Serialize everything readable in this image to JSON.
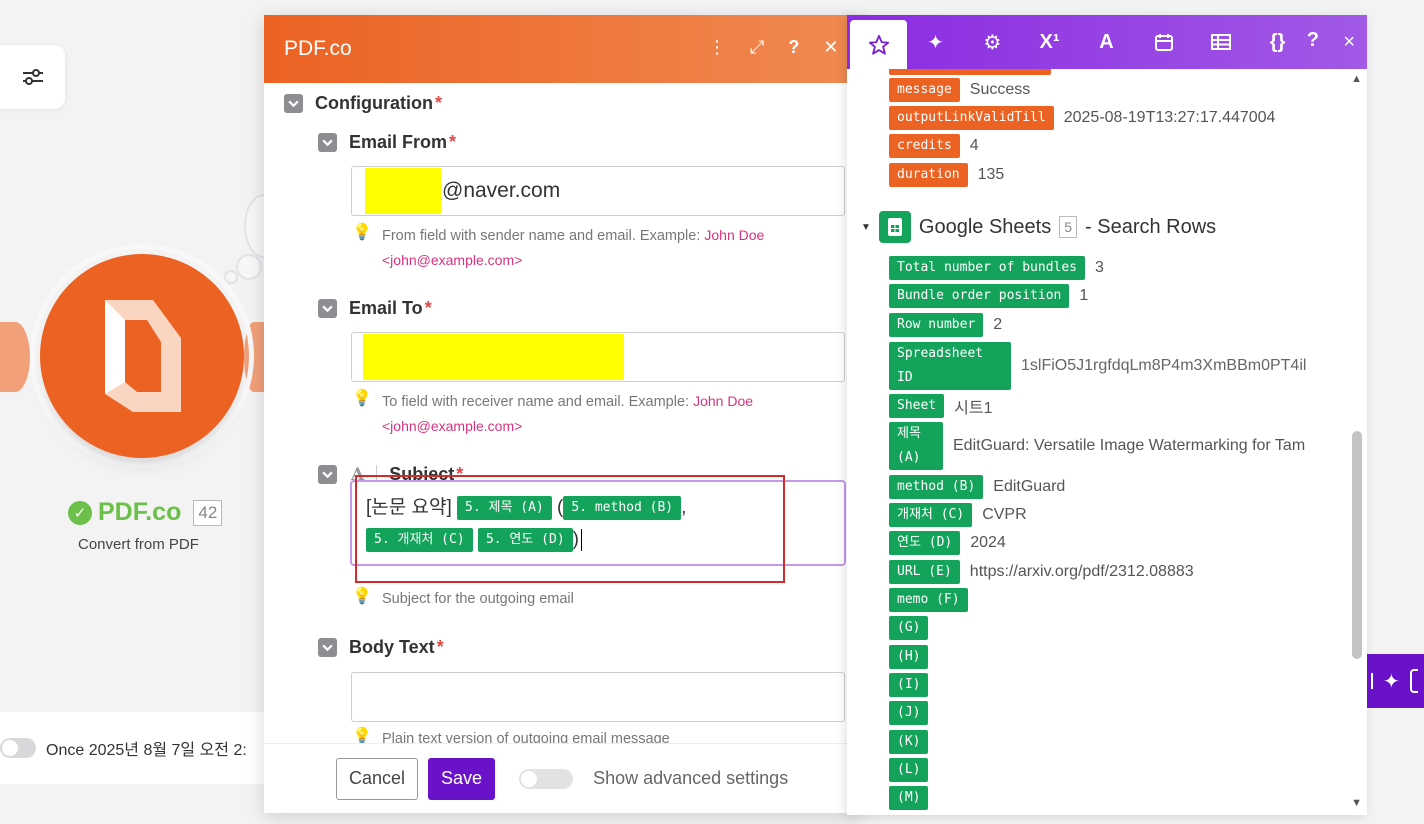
{
  "canvas": {
    "node": {
      "name": "PDF.co",
      "badge": "42",
      "subtitle": "Convert from PDF"
    },
    "schedule": {
      "text": "Once 2025년 8월 7일 오전 2:"
    }
  },
  "modal": {
    "title": "PDF.co",
    "section": {
      "label": "Configuration",
      "required": "*"
    },
    "email_from": {
      "label": "Email From",
      "required": "*",
      "value": "@naver.com",
      "hint": "From field with sender name and email. Example:",
      "example": "John Doe <john@example.com>"
    },
    "email_to": {
      "label": "Email To",
      "required": "*",
      "hint": "To field with receiver name and email. Example:",
      "example": "John Doe <john@example.com>"
    },
    "subject": {
      "label": "Subject",
      "required": "*",
      "prefix": "[논문 요약]",
      "pill1": "5. 제목 (A)",
      "open": "(",
      "pill2": "5. method (B)",
      "comma": ",",
      "pill3": "5. 개재처 (C)",
      "pill4": "5. 연도 (D)",
      "close": ")",
      "hint": "Subject for the outgoing email"
    },
    "body_text": {
      "label": "Body Text",
      "required": "*",
      "hint": "Plain text version of outgoing email message"
    },
    "footer": {
      "cancel": "Cancel",
      "save": "Save",
      "advanced": "Show advanced settings"
    }
  },
  "panel": {
    "tabs": [
      "star",
      "sparkle",
      "settings",
      "x1",
      "A",
      "calendar",
      "table",
      "braces"
    ],
    "help": "?",
    "close": "×",
    "pdfco_items": [
      {
        "key": "message",
        "value": "Success"
      },
      {
        "key": "outputLinkValidTill",
        "value": "2025-08-19T13:27:17.447004"
      },
      {
        "key": "credits",
        "value": "4"
      },
      {
        "key": "duration",
        "value": "135"
      }
    ],
    "module": {
      "name": "Google Sheets",
      "badge": "5",
      "action": "- Search Rows"
    },
    "sheet_items": [
      {
        "key": "Total number of bundles",
        "value": "3"
      },
      {
        "key": "Bundle order position",
        "value": "1"
      },
      {
        "key": "Row number",
        "value": "2"
      },
      {
        "key": "Spreadsheet ID",
        "value": "1slFiO5J1rgfdqLm8P4m3XmBBm0PT4il"
      },
      {
        "key": "Sheet",
        "value": "시트1"
      },
      {
        "key": "제목 (A)",
        "value": "EditGuard: Versatile Image Watermarking for Tam"
      },
      {
        "key": "method (B)",
        "value": "EditGuard"
      },
      {
        "key": "개재처 (C)",
        "value": "CVPR"
      },
      {
        "key": "연도 (D)",
        "value": "2024"
      },
      {
        "key": "URL (E)",
        "value": "https://arxiv.org/pdf/2312.08883"
      },
      {
        "key": "memo (F)",
        "value": ""
      },
      {
        "key": "(G)",
        "value": ""
      },
      {
        "key": "(H)",
        "value": ""
      },
      {
        "key": "(I)",
        "value": ""
      },
      {
        "key": "(J)",
        "value": ""
      },
      {
        "key": "(K)",
        "value": ""
      },
      {
        "key": "(L)",
        "value": ""
      },
      {
        "key": "(M)",
        "value": ""
      }
    ]
  },
  "colors": {
    "pdfco_orange": "#ec6223",
    "sheets_green": "#13a35a",
    "panel_purple": "#8a2be2",
    "save_purple": "#6a12c9",
    "highlight": "#ffff00",
    "frame_red": "#d42a2a"
  }
}
